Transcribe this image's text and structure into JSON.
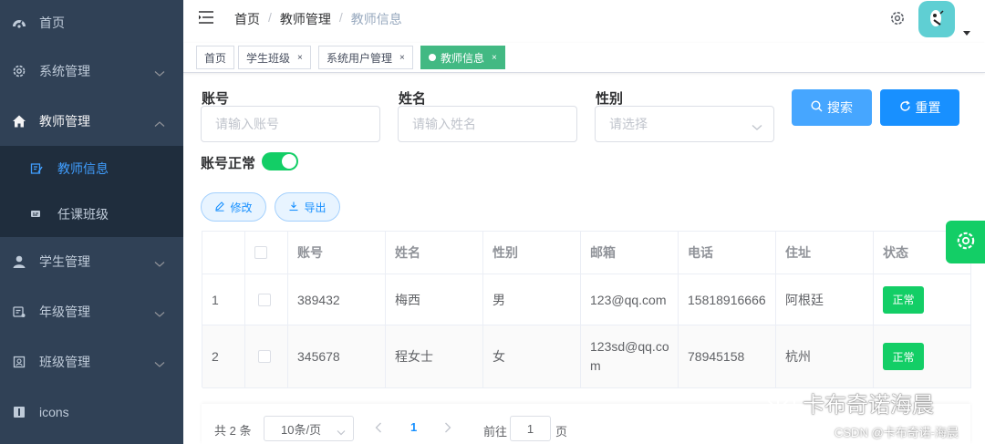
{
  "sidebar": {
    "items": [
      {
        "label": "首页",
        "icon": "dashboard-icon"
      },
      {
        "label": "系统管理",
        "icon": "settings-icon"
      },
      {
        "label": "教师管理",
        "icon": "home-icon"
      },
      {
        "label": "学生管理",
        "icon": "user-icon"
      },
      {
        "label": "年级管理",
        "icon": "grade-icon"
      },
      {
        "label": "班级管理",
        "icon": "class-icon"
      },
      {
        "label": "icons",
        "icon": "info-icon"
      }
    ],
    "sub_items": [
      {
        "label": "教师信息",
        "icon": "edit-doc-icon"
      },
      {
        "label": "任课班级",
        "icon": "course-icon"
      }
    ]
  },
  "header": {
    "breadcrumb": [
      "首页",
      "教师管理",
      "教师信息"
    ],
    "separator": "/"
  },
  "tags": [
    {
      "label": "首页"
    },
    {
      "label": "学生班级",
      "close": "×"
    },
    {
      "label": "系统用户管理",
      "close": "×"
    },
    {
      "label": "教师信息",
      "close": "×"
    }
  ],
  "form": {
    "account_label": "账号",
    "account_placeholder": "请输入账号",
    "name_label": "姓名",
    "name_placeholder": "请输入姓名",
    "gender_label": "性别",
    "gender_placeholder": "请选择",
    "status_label": "账号正常",
    "status_on": true,
    "search_label": "搜索",
    "reset_label": "重置",
    "edit_label": "修改",
    "export_label": "导出"
  },
  "table": {
    "columns": [
      "",
      "",
      "账号",
      "姓名",
      "性别",
      "邮箱",
      "电话",
      "住址",
      "状态"
    ],
    "rows": [
      {
        "index": "1",
        "account": "389432",
        "name": "梅西",
        "gender": "男",
        "email": "123@qq.com",
        "phone": "15818916666",
        "address": "阿根廷",
        "status": "正常"
      },
      {
        "index": "2",
        "account": "345678",
        "name": "程女士",
        "gender": "女",
        "email": "123sd@qq.com",
        "phone": "78945158",
        "address": "杭州",
        "status": "正常"
      }
    ]
  },
  "pagination": {
    "total": "共 2 条",
    "page_size": "10条/页",
    "current_page": "1",
    "goto_label": "前往",
    "goto_value": "1",
    "page_unit": "页"
  },
  "watermark": {
    "main": "卡布奇诺海晨",
    "sub": "CSDN @卡布奇诺-海晨"
  },
  "colors": {
    "sidebar_bg": "#304156",
    "submenu_bg": "#1f2d3d",
    "active_link": "#409eff",
    "tag_active": "#42b983",
    "success": "#13ce66",
    "primary": "#1890ff"
  }
}
